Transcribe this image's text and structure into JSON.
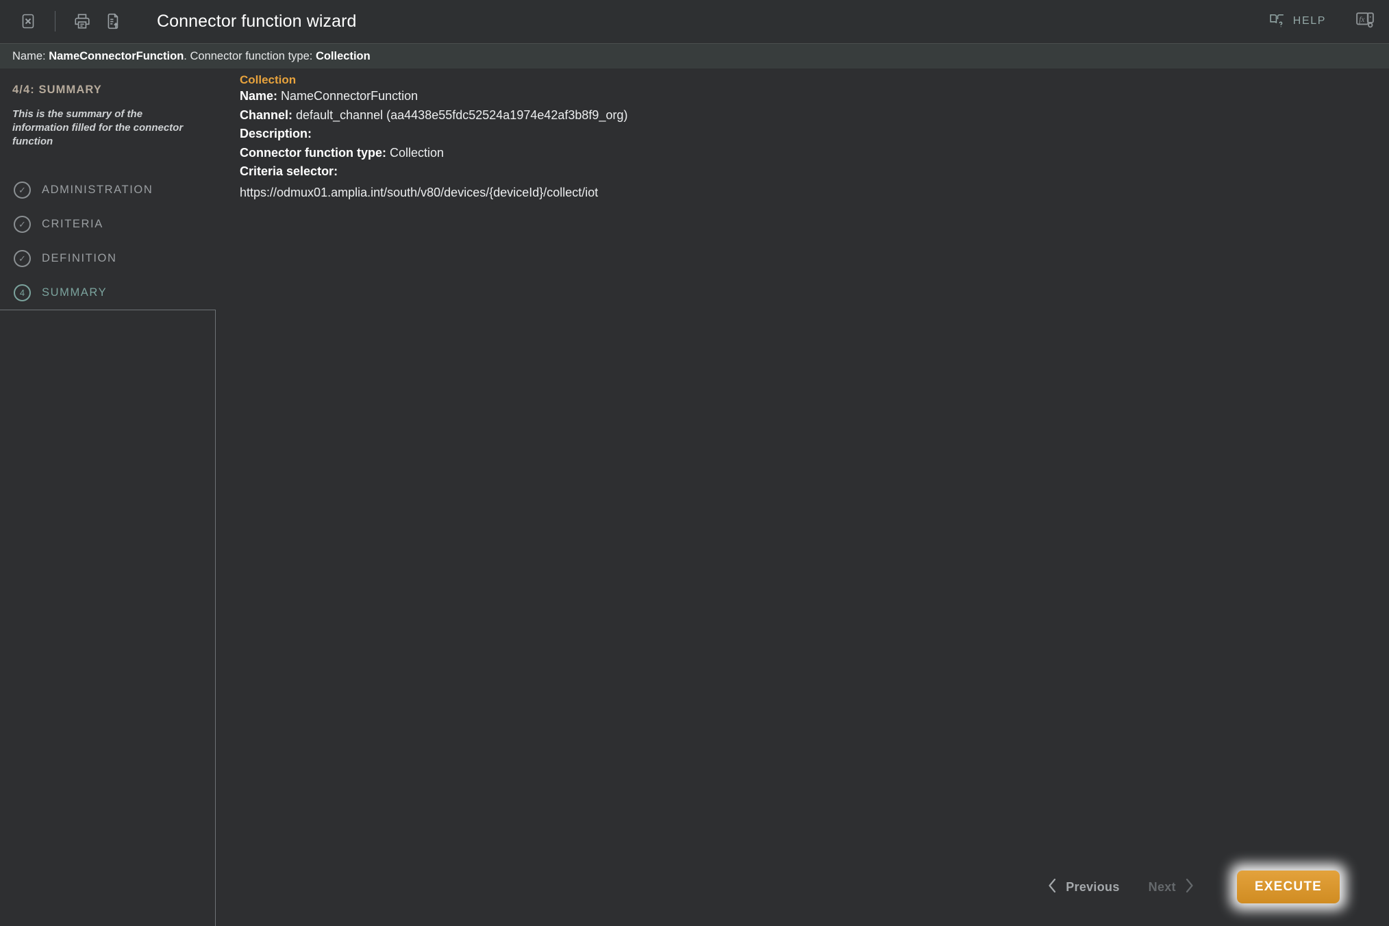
{
  "window": {
    "title": "Connector function wizard",
    "close_icon": "close-box-icon",
    "print_icon": "printer-icon",
    "export_icon": "document-export-icon",
    "help_label": "HELP",
    "help_icon": "book-help-icon",
    "fx_icon": "fx-function-icon"
  },
  "breadcrumb": {
    "name_label": "Name:",
    "name_value": "NameConnectorFunction",
    "separator": ".",
    "type_label": "Connector function type:",
    "type_value": "Collection"
  },
  "sidebar": {
    "step_heading": "4/4: SUMMARY",
    "step_description": "This is the summary of the information filled for the connector function",
    "steps": [
      {
        "label": "ADMINISTRATION",
        "marker": "✓",
        "state": "done"
      },
      {
        "label": "CRITERIA",
        "marker": "✓",
        "state": "done"
      },
      {
        "label": "DEFINITION",
        "marker": "✓",
        "state": "done"
      },
      {
        "label": "SUMMARY",
        "marker": "4",
        "state": "active"
      }
    ]
  },
  "summary": {
    "section_title": "Collection",
    "rows": [
      {
        "label": "Name:",
        "value": "NameConnectorFunction"
      },
      {
        "label": "Channel:",
        "value": "default_channel (aa4438e55fdc52524a1974e42af3b8f9_org)"
      },
      {
        "label": "Description:",
        "value": ""
      },
      {
        "label": "Connector function type:",
        "value": "Collection"
      },
      {
        "label": "Criteria selector:",
        "value": ""
      }
    ],
    "criteria_selector_url": "https://odmux01.amplia.int/south/v80/devices/{deviceId}/collect/iot"
  },
  "footer": {
    "previous_label": "Previous",
    "next_label": "Next",
    "execute_label": "EXECUTE",
    "prev_icon": "chevron-left-icon",
    "next_icon": "chevron-right-icon"
  },
  "colors": {
    "accent_orange": "#e8a33d",
    "accent_teal": "#7ba39d",
    "header_bg": "#2e3032",
    "crumb_bg": "#383d3d",
    "body_bg": "#2e2f31"
  }
}
